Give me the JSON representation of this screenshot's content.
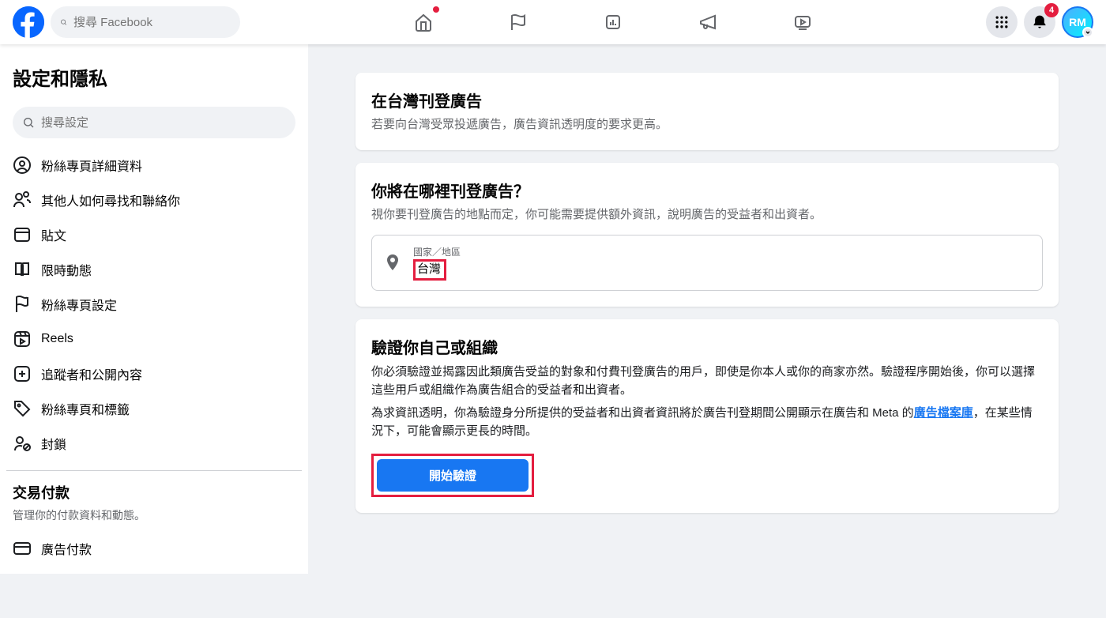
{
  "header": {
    "search_placeholder": "搜尋 Facebook",
    "notifications_count": "4",
    "avatar_text": "RM"
  },
  "sidebar": {
    "title": "設定和隱私",
    "search_placeholder": "搜尋設定",
    "items": [
      {
        "label": "粉絲專頁詳細資料"
      },
      {
        "label": "其他人如何尋找和聯絡你"
      },
      {
        "label": "貼文"
      },
      {
        "label": "限時動態"
      },
      {
        "label": "粉絲專頁設定"
      },
      {
        "label": "Reels"
      },
      {
        "label": "追蹤者和公開內容"
      },
      {
        "label": "粉絲專頁和標籤"
      },
      {
        "label": "封鎖"
      }
    ],
    "section_title": "交易付款",
    "section_sub": "管理你的付款資料和動態。",
    "payment_item": "廣告付款"
  },
  "main": {
    "card1": {
      "title": "在台灣刊登廣告",
      "desc": "若要向台灣受眾投遞廣告，廣告資訊透明度的要求更高。"
    },
    "card2": {
      "title": "你將在哪裡刊登廣告？",
      "desc": "視你要刊登廣告的地點而定，你可能需要提供額外資訊，說明廣告的受益者和出資者。",
      "country_label": "國家／地區",
      "country_value": "台灣"
    },
    "card3": {
      "title": "驗證你自己或組織",
      "body1": "你必須驗證並揭露因此類廣告受益的對象和付費刊登廣告的用戶，即使是你本人或你的商家亦然。驗證程序開始後，你可以選擇這些用戶或組織作為廣告組合的受益者和出資者。",
      "body2a": "為求資訊透明，你為驗證身分所提供的受益者和出資者資訊將於廣告刊登期間公開顯示在廣告和 Meta 的",
      "body2_link": "廣告檔案庫",
      "body2b": "，在某些情況下，可能會顯示更長的時間。",
      "button": "開始驗證"
    }
  }
}
